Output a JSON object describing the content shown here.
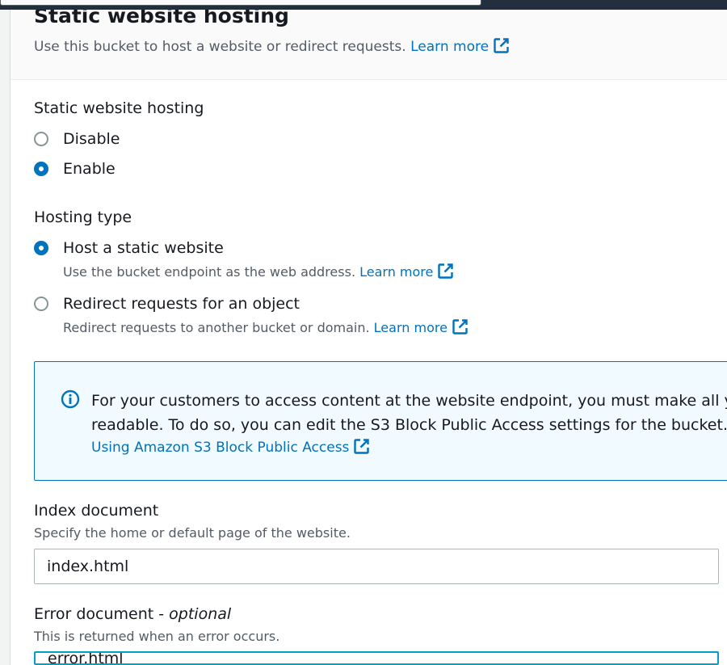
{
  "header": {
    "title": "Static website hosting",
    "description": "Use this bucket to host a website or redirect requests.",
    "learn_more": "Learn more"
  },
  "hosting": {
    "label": "Static website hosting",
    "options": [
      {
        "label": "Disable",
        "selected": false
      },
      {
        "label": "Enable",
        "selected": true
      }
    ]
  },
  "hosting_type": {
    "label": "Hosting type",
    "options": [
      {
        "label": "Host a static website",
        "description": "Use the bucket endpoint as the web address.",
        "link": "Learn more",
        "selected": true
      },
      {
        "label": "Redirect requests for an object",
        "description": "Redirect requests to another bucket or domain.",
        "link": "Learn more",
        "selected": false
      }
    ]
  },
  "info_alert": {
    "line1": "For your customers to access content at the website endpoint, you must make all yo",
    "line2": "readable. To do so, you can edit the S3 Block Public Access settings for the bucket.",
    "link": "Using Amazon S3 Block Public Access"
  },
  "index_document": {
    "label": "Index document",
    "description": "Specify the home or default page of the website.",
    "value": "index.html"
  },
  "error_document": {
    "label": "Error document - ",
    "label_optional": "optional",
    "description": "This is returned when an error occurs.",
    "value": "error.html"
  },
  "colors": {
    "link": "#0073bb",
    "radio_selected": "#0073bb",
    "info_bg": "#f1faff",
    "focus_border": "#00a1c9"
  }
}
